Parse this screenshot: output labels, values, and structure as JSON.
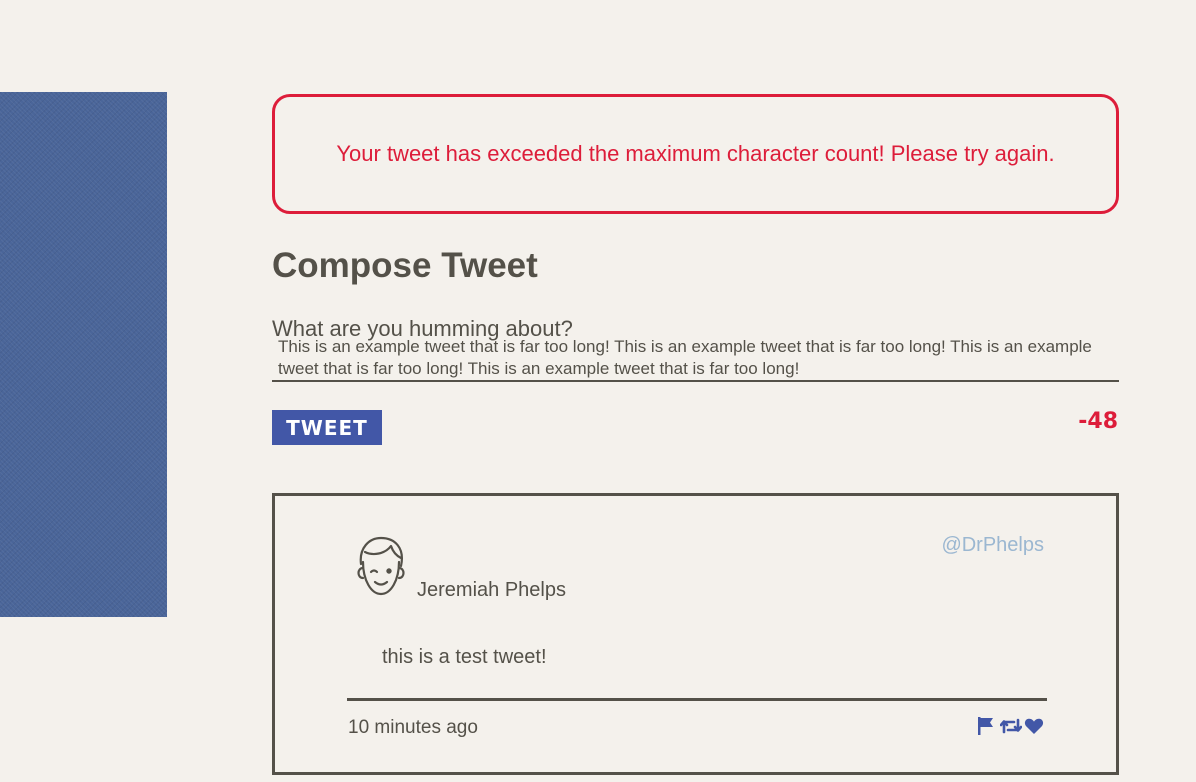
{
  "error": {
    "message": "Your tweet has exceeded the maximum character count! Please try again."
  },
  "compose": {
    "title": "Compose Tweet",
    "label": "What are you humming about?",
    "text": "This is an example tweet that is far too long! This is an example tweet that is far too long! This is an example tweet that is far too long! This is an example tweet that is far too long!",
    "button_label": "Tweet",
    "counter": "-48"
  },
  "tweet": {
    "display_name": "Jeremiah Phelps",
    "handle": "@DrPhelps",
    "content": "this is a test tweet!",
    "timestamp": "10 minutes ago",
    "actions": [
      "flag-icon",
      "retweet-icon",
      "heart-icon"
    ]
  },
  "colors": {
    "background": "#f4f1ec",
    "text": "#545149",
    "error": "#dd1d3a",
    "accent": "#4257a7",
    "handle": "#9bb7d1",
    "sidebar": "#4a6599"
  }
}
